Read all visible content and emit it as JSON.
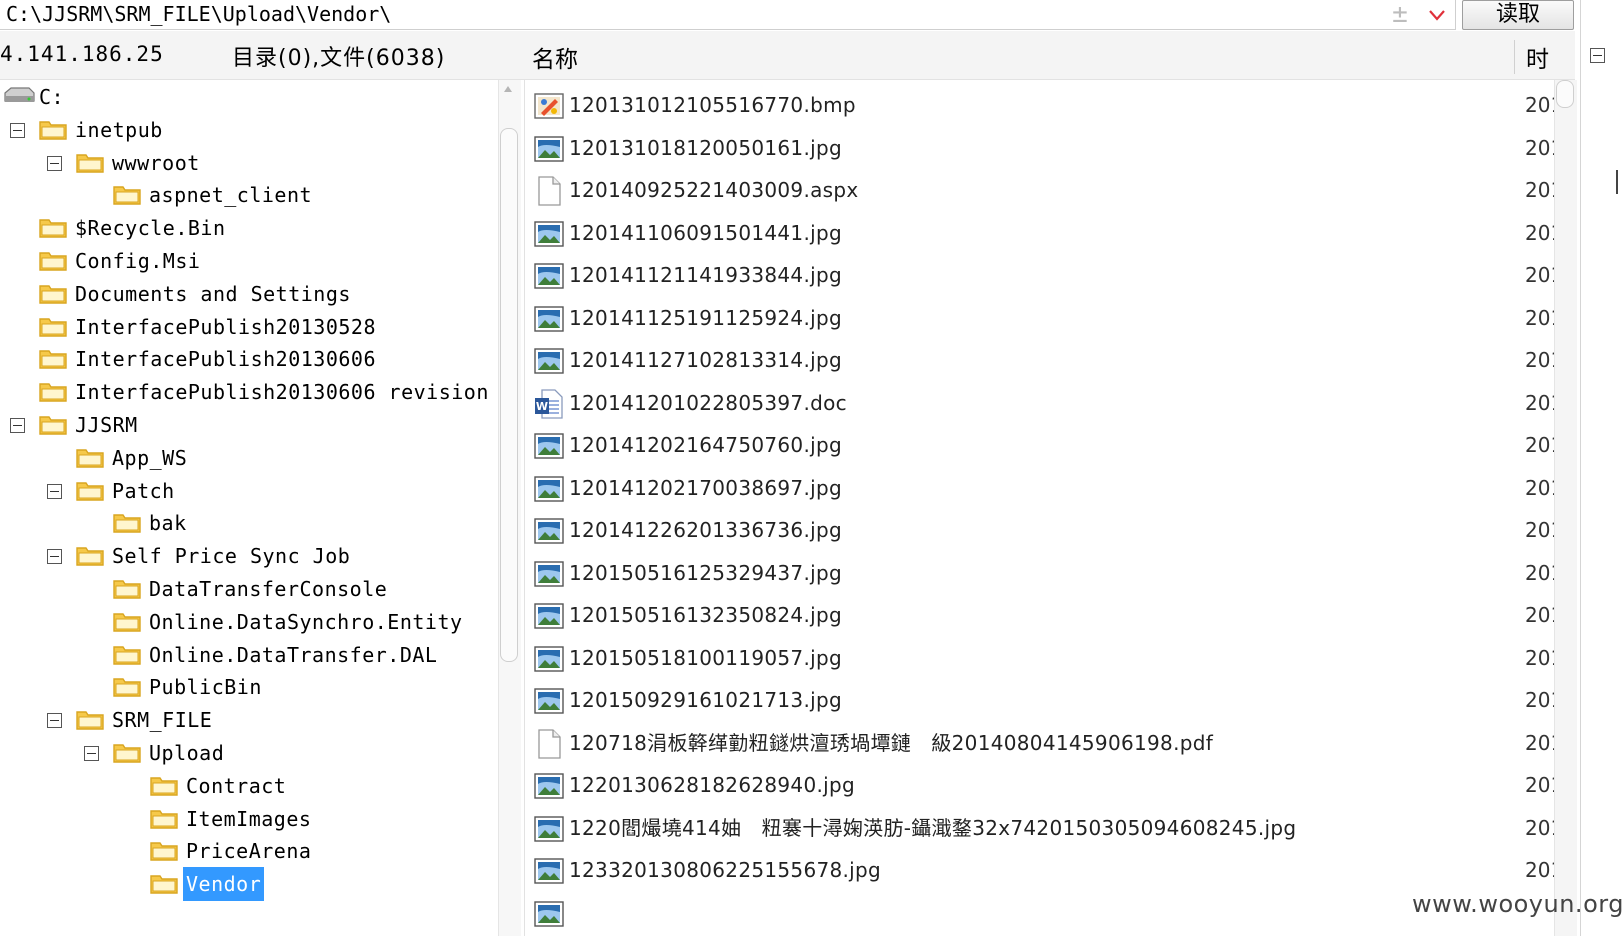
{
  "pathbar": {
    "path": "C:\\JJSRM\\SRM_FILE\\Upload\\Vendor\\",
    "add_glyph": "±",
    "read_button": "读取"
  },
  "header": {
    "ip": "4.141.186.25",
    "dir_count": "目录(0),文件(6038)",
    "col_name": "名称",
    "col_time": "时"
  },
  "tree": [
    {
      "label": "C:",
      "indent": 0,
      "icon": "drive",
      "toggle": false
    },
    {
      "label": "inetpub",
      "indent": 1,
      "icon": "folder",
      "toggle": true
    },
    {
      "label": "wwwroot",
      "indent": 2,
      "icon": "folder",
      "toggle": true
    },
    {
      "label": "aspnet_client",
      "indent": 3,
      "icon": "folder",
      "toggle": false
    },
    {
      "label": "$Recycle.Bin",
      "indent": 1,
      "icon": "folder",
      "toggle": false
    },
    {
      "label": "Config.Msi",
      "indent": 1,
      "icon": "folder",
      "toggle": false
    },
    {
      "label": "Documents and Settings",
      "indent": 1,
      "icon": "folder",
      "toggle": false
    },
    {
      "label": "InterfacePublish20130528",
      "indent": 1,
      "icon": "folder",
      "toggle": false
    },
    {
      "label": "InterfacePublish20130606",
      "indent": 1,
      "icon": "folder",
      "toggle": false
    },
    {
      "label": "InterfacePublish20130606 revision",
      "indent": 1,
      "icon": "folder",
      "toggle": false
    },
    {
      "label": "JJSRM",
      "indent": 1,
      "icon": "folder",
      "toggle": true
    },
    {
      "label": "App_WS",
      "indent": 2,
      "icon": "folder",
      "toggle": false
    },
    {
      "label": "Patch",
      "indent": 2,
      "icon": "folder",
      "toggle": true
    },
    {
      "label": "bak",
      "indent": 3,
      "icon": "folder",
      "toggle": false
    },
    {
      "label": "Self Price Sync Job",
      "indent": 2,
      "icon": "folder",
      "toggle": true
    },
    {
      "label": "DataTransferConsole",
      "indent": 3,
      "icon": "folder",
      "toggle": false
    },
    {
      "label": "Online.DataSynchro.Entity",
      "indent": 3,
      "icon": "folder",
      "toggle": false
    },
    {
      "label": "Online.DataTransfer.DAL",
      "indent": 3,
      "icon": "folder",
      "toggle": false
    },
    {
      "label": "PublicBin",
      "indent": 3,
      "icon": "folder",
      "toggle": false
    },
    {
      "label": "SRM_FILE",
      "indent": 2,
      "icon": "folder",
      "toggle": true
    },
    {
      "label": "Upload",
      "indent": 3,
      "icon": "folder",
      "toggle": true
    },
    {
      "label": "Contract",
      "indent": 4,
      "icon": "folder",
      "toggle": false
    },
    {
      "label": "ItemImages",
      "indent": 4,
      "icon": "folder",
      "toggle": false
    },
    {
      "label": "PriceArena",
      "indent": 4,
      "icon": "folder",
      "toggle": false
    },
    {
      "label": "Vendor",
      "indent": 4,
      "icon": "folder",
      "toggle": false,
      "selected": true
    }
  ],
  "files": [
    {
      "name": "120131012105516770.bmp",
      "icon": "bmp",
      "time": "201"
    },
    {
      "name": "120131018120050161.jpg",
      "icon": "image",
      "time": "201"
    },
    {
      "name": "120140925221403009.aspx",
      "icon": "blank",
      "time": "201"
    },
    {
      "name": "120141106091501441.jpg",
      "icon": "image",
      "time": "201"
    },
    {
      "name": "120141121141933844.jpg",
      "icon": "image",
      "time": "201"
    },
    {
      "name": "120141125191125924.jpg",
      "icon": "image",
      "time": "201"
    },
    {
      "name": "120141127102813314.jpg",
      "icon": "image",
      "time": "201"
    },
    {
      "name": "120141201022805397.doc",
      "icon": "word",
      "time": "201"
    },
    {
      "name": "120141202164750760.jpg",
      "icon": "image",
      "time": "201"
    },
    {
      "name": "120141202170038697.jpg",
      "icon": "image",
      "time": "201"
    },
    {
      "name": "120141226201336736.jpg",
      "icon": "image",
      "time": "201"
    },
    {
      "name": "120150516125329437.jpg",
      "icon": "image",
      "time": "201"
    },
    {
      "name": "120150516132350824.jpg",
      "icon": "image",
      "time": "201"
    },
    {
      "name": "120150518100119057.jpg",
      "icon": "image",
      "time": "201"
    },
    {
      "name": "120150929161021713.jpg",
      "icon": "image",
      "time": "201"
    },
    {
      "name": "120718涓板簳缂勭粈鐩烘澶琇堝墰鏈　級20140804145906198.pdf",
      "icon": "blank",
      "time": "201"
    },
    {
      "name": "1220130628182628940.jpg",
      "icon": "image",
      "time": "201"
    },
    {
      "name": "1220閻熶墝414妯　粈褰十潯婅渶肪-鑷濈鍪32x7420150305094608245.jpg",
      "icon": "image",
      "time": "201"
    },
    {
      "name": "12332013080622515567​8.jpg",
      "icon": "image",
      "time": "201"
    },
    {
      "name": "",
      "icon": "image",
      "time": ""
    }
  ],
  "watermark": "www.wooyun.org",
  "colors": {
    "selection": "#3399ff",
    "folder": "#f6c94a",
    "folder_dark": "#d9a520",
    "image_blue": "#2a6db0"
  }
}
